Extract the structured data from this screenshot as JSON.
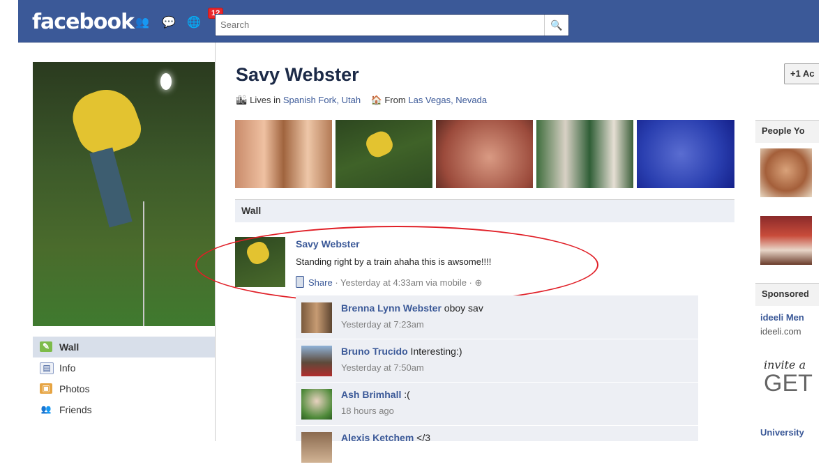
{
  "topbar": {
    "logo": "facebook",
    "notification_count": "12",
    "search_placeholder": "Search"
  },
  "profile": {
    "name": "Savy Webster",
    "lives_in_prefix": "Lives in",
    "lives_in": "Spanish Fork, Utah",
    "from_prefix": "From",
    "from": "Las Vegas, Nevada"
  },
  "nav": {
    "items": [
      {
        "label": "Wall"
      },
      {
        "label": "Info"
      },
      {
        "label": "Photos"
      },
      {
        "label": "Friends"
      }
    ]
  },
  "wall": {
    "heading": "Wall",
    "post": {
      "author": "Savy Webster",
      "text": "Standing right by a train ahaha this is awsome!!!!",
      "share": "Share",
      "meta": "· Yesterday at 4:33am via mobile ·"
    },
    "comments": [
      {
        "author": "Brenna Lynn Webster",
        "text": " oboy sav",
        "time": "Yesterday at 7:23am"
      },
      {
        "author": "Bruno Trucido",
        "text": " Interesting:)",
        "time": "Yesterday at 7:50am"
      },
      {
        "author": "Ash Brimhall",
        "text": " :(",
        "time": "18 hours ago"
      },
      {
        "author": "Alexis Ketchem",
        "text": " </3",
        "time": ""
      }
    ]
  },
  "right": {
    "add_button": "+1 Ac",
    "people_heading": "People Yo",
    "sponsored_heading": "Sponsored",
    "ad_link": "ideeli Men",
    "ad_domain": "ideeli.com",
    "ad_line1": "invite a",
    "ad_line2": "GET",
    "university_heading": "University"
  },
  "colors": {
    "brand": "#3b5998",
    "badge": "#e9262b",
    "highlight_ring": "#e01e26"
  }
}
